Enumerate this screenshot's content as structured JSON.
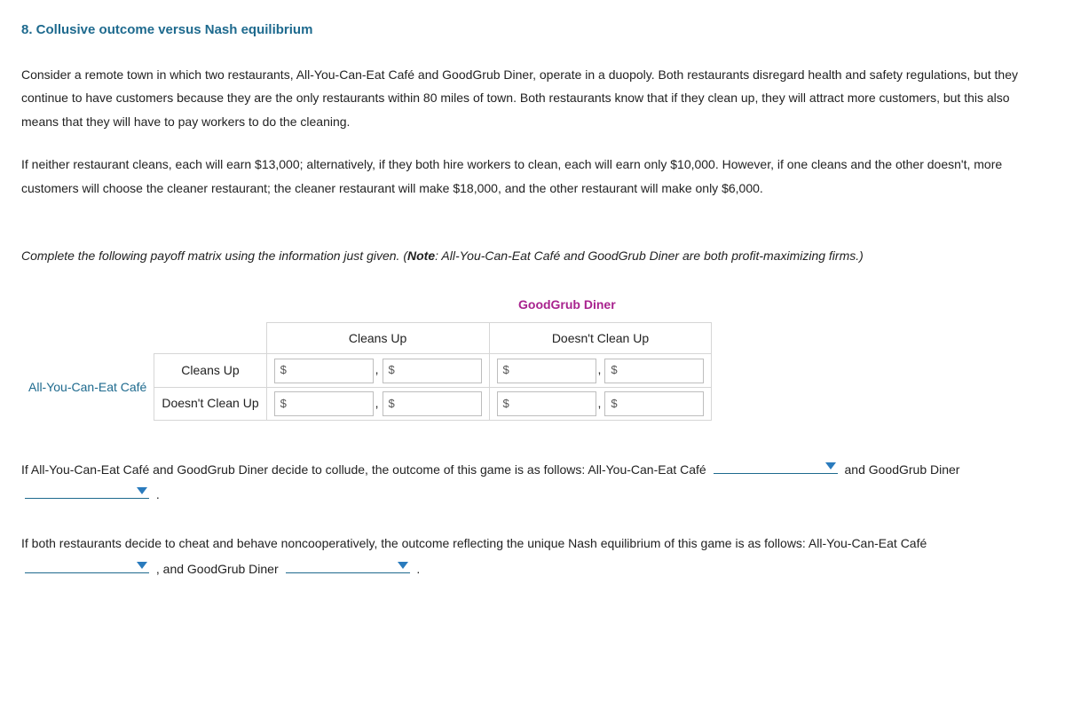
{
  "title": "8. Collusive outcome versus Nash equilibrium",
  "para1": "Consider a remote town in which two restaurants, All-You-Can-Eat Café and GoodGrub Diner, operate in a duopoly. Both restaurants disregard health and safety regulations, but they continue to have customers because they are the only restaurants within 80 miles of town. Both restaurants know that if they clean up, they will attract more customers, but this also means that they will have to pay workers to do the cleaning.",
  "para2": "If neither restaurant cleans, each will earn $13,000; alternatively, if they both hire workers to clean, each will earn only $10,000. However, if one cleans and the other doesn't, more customers will choose the cleaner restaurant; the cleaner restaurant will make $18,000, and the other restaurant will make only $6,000.",
  "instruction_pre": "Complete the following payoff matrix using the information just given. (",
  "instruction_note_label": "Note",
  "instruction_post": ": All-You-Can-Eat Café and GoodGrub Diner are both profit-maximizing firms.)",
  "matrix": {
    "col_player": "GoodGrub Diner",
    "row_player": "All-You-Can-Eat Café",
    "col_labels": [
      "Cleans Up",
      "Doesn't Clean Up"
    ],
    "row_labels": [
      "Cleans Up",
      "Doesn't Clean Up"
    ],
    "dollar_sign": "$",
    "comma": ","
  },
  "q_collude": {
    "pre": "If All-You-Can-Eat Café and GoodGrub Diner decide to collude, the outcome of this game is as follows: All-You-Can-Eat Café",
    "mid": "and GoodGrub Diner",
    "end": "."
  },
  "q_nash": {
    "pre": "If both restaurants decide to cheat and behave noncooperatively, the outcome reflecting the unique Nash equilibrium of this game is as follows: All-You-Can-Eat Café",
    "mid": ", and GoodGrub Diner",
    "end": "."
  }
}
